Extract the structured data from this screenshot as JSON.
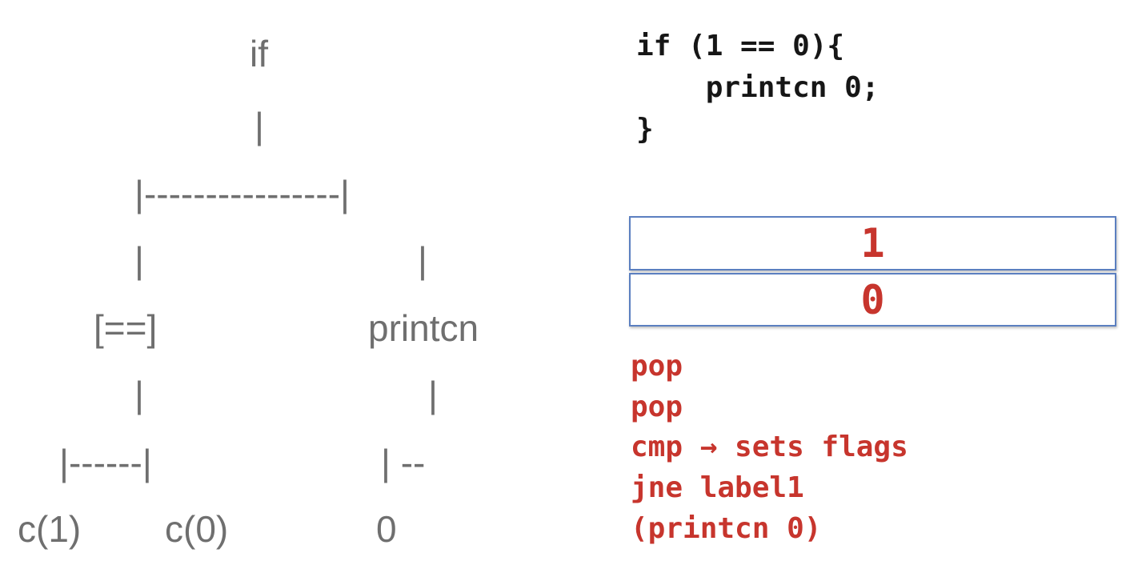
{
  "tree": {
    "root": "if",
    "root_stem": "|",
    "top_branch": "|----------------|",
    "left_stem": "|",
    "right_stem": "|",
    "left_node": "[==]",
    "right_node": "printcn",
    "left_sub_stem": "|",
    "right_sub_stem": "|",
    "left_sub_branch": "|------|",
    "right_sub_branch": "| --",
    "leaf_left": "c(1)",
    "leaf_middle": "c(0)",
    "leaf_right": "0"
  },
  "code": {
    "line1": "if (1 == 0){",
    "line2": "    printcn 0;",
    "line3": "}"
  },
  "stack": {
    "top": "1",
    "bottom": "0"
  },
  "instructions": [
    "pop",
    "pop",
    "cmp → sets flags",
    "jne label1",
    "(printcn 0)"
  ]
}
